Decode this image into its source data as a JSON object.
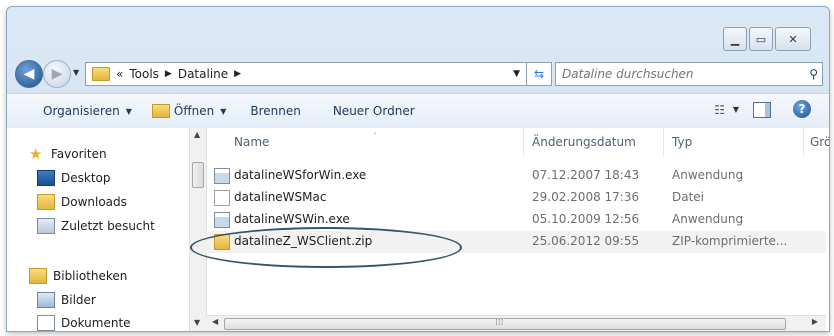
{
  "window": {
    "controls": [
      "minimize-icon",
      "maximize-icon",
      "close-icon"
    ]
  },
  "address": {
    "overflow": "«",
    "crumbs": [
      "Tools",
      "Dataline"
    ],
    "search_placeholder": "Dataline durchsuchen"
  },
  "toolbar": {
    "organize": "Organisieren",
    "open": "Öffnen",
    "burn": "Brennen",
    "new_folder": "Neuer Ordner"
  },
  "navpane": {
    "favorites": "Favoriten",
    "desktop": "Desktop",
    "downloads": "Downloads",
    "recent": "Zuletzt besucht",
    "libraries": "Bibliotheken",
    "pictures": "Bilder",
    "documents": "Dokumente"
  },
  "columns": {
    "name": "Name",
    "date": "Änderungsdatum",
    "type": "Typ",
    "size": "Grö"
  },
  "files": [
    {
      "name": "datalineWSforWin.exe",
      "date": "07.12.2007 18:43",
      "type": "Anwendung",
      "icon": "exe-icon"
    },
    {
      "name": "datalineWSMac",
      "date": "29.02.2008 17:36",
      "type": "Datei",
      "icon": "file-icon"
    },
    {
      "name": "datalineWSWin.exe",
      "date": "05.10.2009 12:56",
      "type": "Anwendung",
      "icon": "exe-icon"
    },
    {
      "name": "datalineZ_WSClient.zip",
      "date": "25.06.2012 09:55",
      "type": "ZIP-komprimierte...",
      "icon": "zip-icon"
    }
  ],
  "colors": {
    "frame": "#dbe8f5",
    "highlight_ellipse": "#31566e"
  }
}
